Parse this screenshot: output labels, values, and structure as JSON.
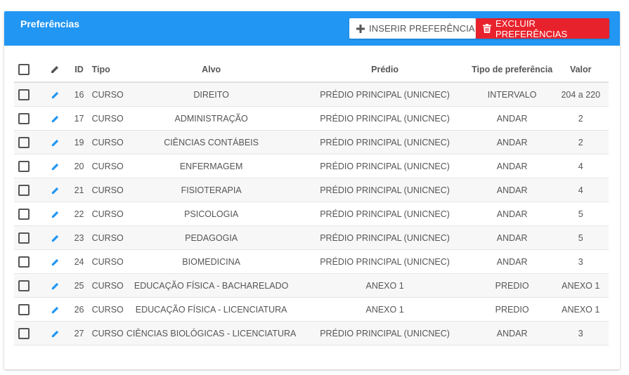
{
  "header": {
    "title": "Preferências",
    "insert_label": "INSERIR PREFERÊNCIA",
    "delete_label": "EXCLUIR PREFERÊNCIAS"
  },
  "colors": {
    "primary": "#2196f3",
    "danger": "#e8222c"
  },
  "table": {
    "columns": {
      "id": "ID",
      "tipo": "Tipo",
      "alvo": "Alvo",
      "predio": "Prédio",
      "tipo_pref": "Tipo de preferência",
      "valor": "Valor"
    },
    "rows": [
      {
        "id": "16",
        "tipo": "CURSO",
        "alvo": "DIREITO",
        "predio": "PRÉDIO PRINCIPAL (UNICNEC)",
        "tipo_pref": "INTERVALO",
        "valor": "204 a 220"
      },
      {
        "id": "17",
        "tipo": "CURSO",
        "alvo": "ADMINISTRAÇÃO",
        "predio": "PRÉDIO PRINCIPAL (UNICNEC)",
        "tipo_pref": "ANDAR",
        "valor": "2"
      },
      {
        "id": "19",
        "tipo": "CURSO",
        "alvo": "CIÊNCIAS CONTÁBEIS",
        "predio": "PRÉDIO PRINCIPAL (UNICNEC)",
        "tipo_pref": "ANDAR",
        "valor": "2"
      },
      {
        "id": "20",
        "tipo": "CURSO",
        "alvo": "ENFERMAGEM",
        "predio": "PRÉDIO PRINCIPAL (UNICNEC)",
        "tipo_pref": "ANDAR",
        "valor": "4"
      },
      {
        "id": "21",
        "tipo": "CURSO",
        "alvo": "FISIOTERAPIA",
        "predio": "PRÉDIO PRINCIPAL (UNICNEC)",
        "tipo_pref": "ANDAR",
        "valor": "4"
      },
      {
        "id": "22",
        "tipo": "CURSO",
        "alvo": "PSICOLOGIA",
        "predio": "PRÉDIO PRINCIPAL (UNICNEC)",
        "tipo_pref": "ANDAR",
        "valor": "5"
      },
      {
        "id": "23",
        "tipo": "CURSO",
        "alvo": "PEDAGOGIA",
        "predio": "PRÉDIO PRINCIPAL (UNICNEC)",
        "tipo_pref": "ANDAR",
        "valor": "5"
      },
      {
        "id": "24",
        "tipo": "CURSO",
        "alvo": "BIOMEDICINA",
        "predio": "PRÉDIO PRINCIPAL (UNICNEC)",
        "tipo_pref": "ANDAR",
        "valor": "3"
      },
      {
        "id": "25",
        "tipo": "CURSO",
        "alvo": "EDUCAÇÃO FÍSICA - BACHARELADO",
        "predio": "ANEXO 1",
        "tipo_pref": "PREDIO",
        "valor": "ANEXO 1"
      },
      {
        "id": "26",
        "tipo": "CURSO",
        "alvo": "EDUCAÇÃO FÍSICA - LICENCIATURA",
        "predio": "ANEXO 1",
        "tipo_pref": "PREDIO",
        "valor": "ANEXO 1"
      },
      {
        "id": "27",
        "tipo": "CURSO",
        "alvo": "CIÊNCIAS BIOLÓGICAS - LICENCIATURA",
        "predio": "PRÉDIO PRINCIPAL (UNICNEC)",
        "tipo_pref": "ANDAR",
        "valor": "3"
      }
    ]
  }
}
